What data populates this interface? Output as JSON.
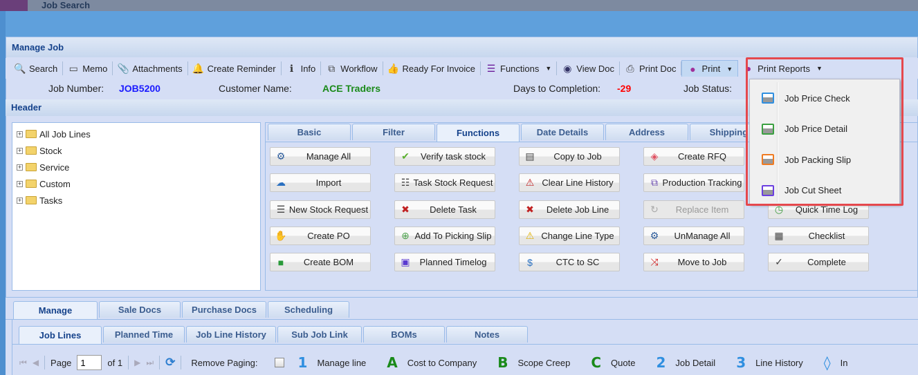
{
  "window": {
    "background_title": "Job Search",
    "title": "Manage Job",
    "header_title": "Header"
  },
  "toolbar": [
    {
      "label": "Search",
      "icon": "search-icon"
    },
    {
      "label": "Memo",
      "icon": "memo-icon"
    },
    {
      "label": "Attachments",
      "icon": "paperclip-icon"
    },
    {
      "label": "Create Reminder",
      "icon": "bell-icon"
    },
    {
      "label": "Info",
      "icon": "info-icon"
    },
    {
      "label": "Workflow",
      "icon": "workflow-icon"
    },
    {
      "label": "Ready For Invoice",
      "icon": "thumbs-up-icon"
    },
    {
      "label": "Functions",
      "icon": "menu-bars-icon",
      "dropdown": true
    },
    {
      "label": "View Doc",
      "icon": "eye-icon"
    },
    {
      "label": "Print Doc",
      "icon": "printer-icon"
    },
    {
      "label": "Print",
      "icon": "paw-icon",
      "dropdown": true,
      "active": true
    },
    {
      "label": "Print Reports",
      "icon": "paw-icon",
      "dropdown": true
    }
  ],
  "info": {
    "job_number_label": "Job Number:",
    "job_number": "JOB5200",
    "customer_label": "Customer Name:",
    "customer": "ACE Traders",
    "days_label": "Days to Completion:",
    "days": "-29",
    "status_label": "Job Status:"
  },
  "tree": [
    "All Job Lines",
    "Stock",
    "Service",
    "Custom",
    "Tasks"
  ],
  "header_tabs": [
    "Basic",
    "Filter",
    "Functions",
    "Date Details",
    "Address",
    "Shipping /",
    "Histor"
  ],
  "header_tab_selected": "Functions",
  "function_buttons": [
    [
      {
        "label": "Manage All",
        "icon": "users-gear-icon"
      },
      {
        "label": "Verify task stock",
        "icon": "shield-check-icon"
      },
      {
        "label": "Copy to Job",
        "icon": "copy-doc-icon"
      },
      {
        "label": "Create RFQ",
        "icon": "tag-icon"
      },
      null
    ],
    [
      {
        "label": "Import",
        "icon": "cloud-upload-icon"
      },
      {
        "label": "Task Stock Request",
        "icon": "person-list-icon"
      },
      {
        "label": "Clear Line History",
        "icon": "warning-x-icon"
      },
      {
        "label": "Production Tracking",
        "icon": "tracking-icon"
      },
      null
    ],
    [
      {
        "label": "New Stock Request",
        "icon": "checklist-icon"
      },
      {
        "label": "Delete Task",
        "icon": "red-x-icon"
      },
      {
        "label": "Delete Job Line",
        "icon": "red-x-icon"
      },
      {
        "label": "Replace Item",
        "icon": "replace-icon",
        "disabled": true
      },
      {
        "label": "Quick Time Log",
        "icon": "clock-icon"
      }
    ],
    [
      {
        "label": "Create PO",
        "icon": "po-icon"
      },
      {
        "label": "Add To Picking Slip",
        "icon": "plus-circle-icon"
      },
      {
        "label": "Change Line Type",
        "icon": "warning-icon"
      },
      {
        "label": "UnManage All",
        "icon": "users-gear-icon"
      },
      {
        "label": "Checklist",
        "icon": "clipboard-icon"
      }
    ],
    [
      {
        "label": "Create BOM",
        "icon": "bom-icon"
      },
      {
        "label": "Planned Timelog",
        "icon": "calendar-lock-icon"
      },
      {
        "label": "CTC to SC",
        "icon": "ctc-icon"
      },
      {
        "label": "Move to Job",
        "icon": "shuffle-icon"
      },
      {
        "label": "Complete",
        "icon": "checkmark-icon"
      }
    ]
  ],
  "print_menu": [
    {
      "label": "Job Price Check",
      "color": "#2f8fe0"
    },
    {
      "label": "Job Price Detail",
      "color": "#3aa040"
    },
    {
      "label": "Job Packing Slip",
      "color": "#f07a20"
    },
    {
      "label": "Job Cut Sheet",
      "color": "#6a3ee0"
    }
  ],
  "bottom_tabs": [
    "Manage",
    "Sale Docs",
    "Purchase Docs",
    "Scheduling"
  ],
  "sub_tabs": [
    "Job Lines",
    "Planned Time",
    "Job Line History",
    "Sub Job Link",
    "BOMs",
    "Notes"
  ],
  "paging": {
    "page_label": "Page",
    "page": "1",
    "of": "of 1",
    "remove_paging": "Remove Paging:"
  },
  "legend": [
    {
      "key": "1",
      "label": "Manage line",
      "color": "#2f8fe0"
    },
    {
      "key": "A",
      "label": "Cost to Company",
      "color": "#1a8a1a"
    },
    {
      "key": "B",
      "label": "Scope Creep",
      "color": "#1a8a1a"
    },
    {
      "key": "C",
      "label": "Quote",
      "color": "#1a8a1a"
    },
    {
      "key": "2",
      "label": "Job Detail",
      "color": "#2f8fe0"
    },
    {
      "key": "3",
      "label": "Line History",
      "color": "#2f8fe0"
    },
    {
      "key": "◊",
      "label": "In",
      "color": "#2f8fe0"
    }
  ],
  "colors": {
    "job_number": "#1a1aff",
    "customer": "#1a8a1a",
    "days": "#ff0000",
    "highlight": "#e5484d"
  }
}
